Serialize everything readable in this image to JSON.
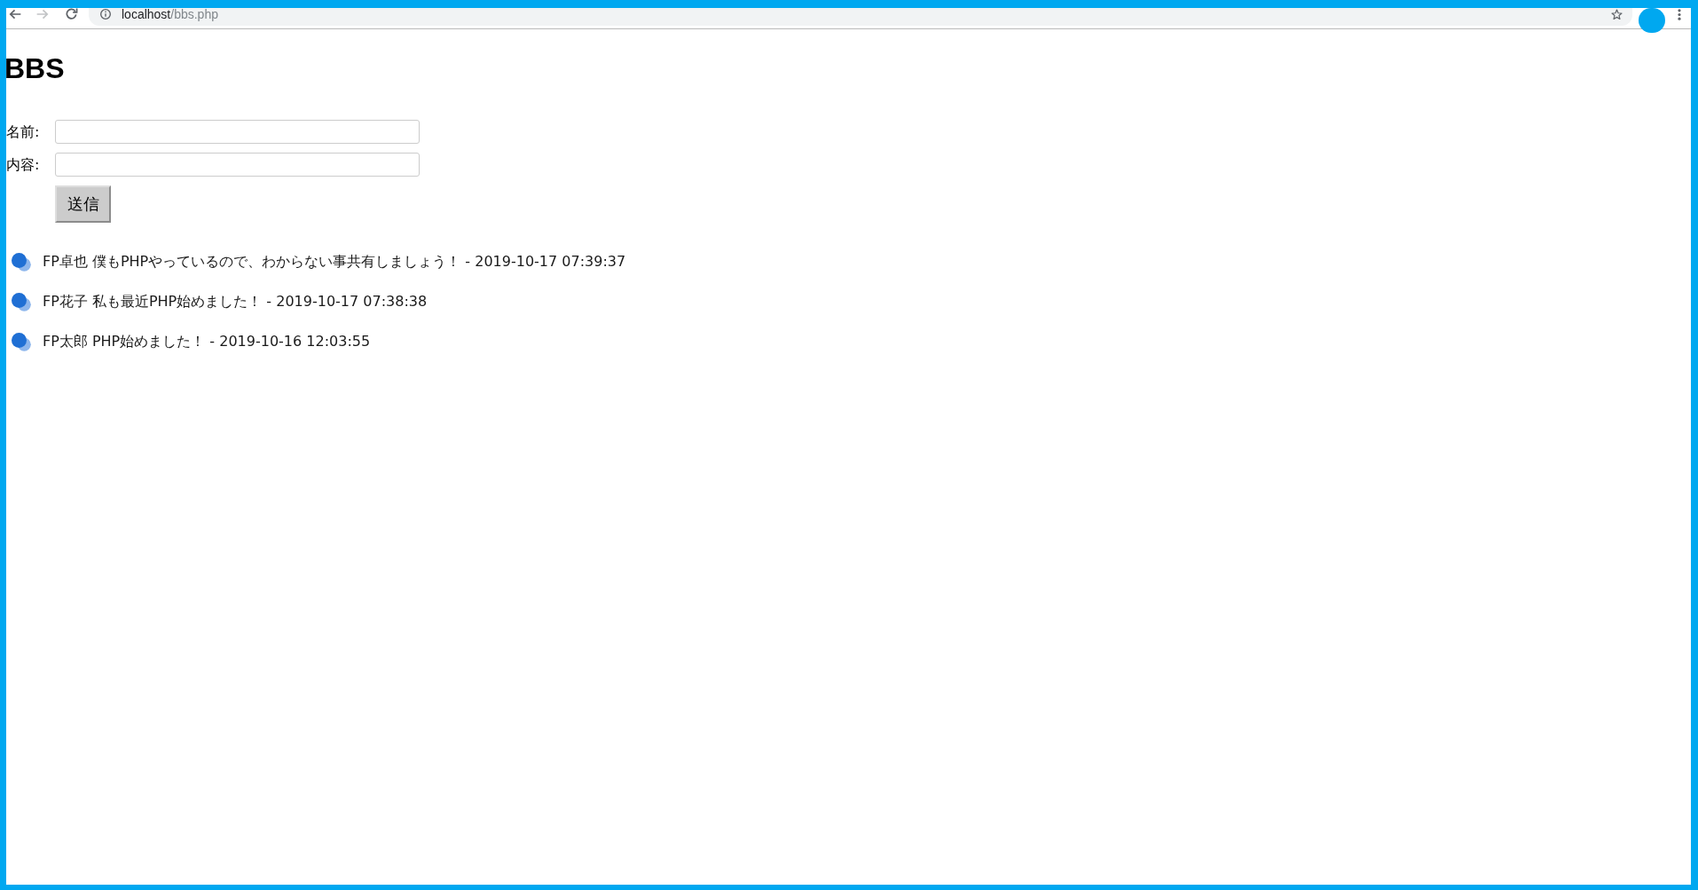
{
  "browser": {
    "nav_buttons": [
      {
        "kind": "back",
        "disabled": false
      },
      {
        "kind": "forward",
        "disabled": true
      },
      {
        "kind": "reload",
        "disabled": false
      }
    ],
    "address_bar": {
      "host": "localhost",
      "path": "/bbs.php"
    }
  },
  "page": {
    "title": "BBS",
    "form": {
      "fields": [
        {
          "label": "名前:"
        },
        {
          "label": "内容:"
        }
      ],
      "submit": "送信"
    },
    "posts": [
      {
        "text": "FP卓也 僕もPHPやっているので、わからない事共有しましょう！ - 2019-10-17 07:39:37"
      },
      {
        "text": "FP花子 私も最近PHP始めました！ - 2019-10-17 07:38:38"
      },
      {
        "text": "FP太郎 PHP始めました！ - 2019-10-16 12:03:55"
      }
    ]
  }
}
